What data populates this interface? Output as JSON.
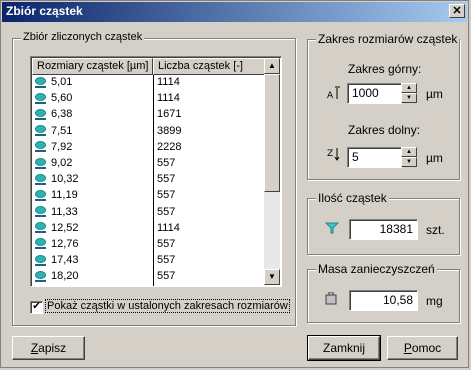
{
  "window": {
    "title": "Zbiór cząstek",
    "close_glyph": "✕"
  },
  "left_group": {
    "label": "Zbiór zliczonych cząstek",
    "columns": [
      "Rozmiary cząstek [µm]",
      "Liczba cząstek [-]"
    ],
    "rows": [
      {
        "size": "5,01",
        "count": "1114"
      },
      {
        "size": "5,60",
        "count": "1114"
      },
      {
        "size": "6,38",
        "count": "1671"
      },
      {
        "size": "7,51",
        "count": "3899"
      },
      {
        "size": "7,92",
        "count": "2228"
      },
      {
        "size": "9,02",
        "count": "557"
      },
      {
        "size": "10,32",
        "count": "557"
      },
      {
        "size": "11,19",
        "count": "557"
      },
      {
        "size": "11,33",
        "count": "557"
      },
      {
        "size": "12,52",
        "count": "1114"
      },
      {
        "size": "12,76",
        "count": "557"
      },
      {
        "size": "17,43",
        "count": "557"
      },
      {
        "size": "18,20",
        "count": "557"
      }
    ],
    "checkbox_checked": true,
    "checkbox_label": "Pokaż cząstki w ustalonych zakresach rozmiarów"
  },
  "range_group": {
    "label": "Zakres rozmiarów cząstek",
    "upper_label": "Zakres górny:",
    "upper_value": "1000",
    "lower_label": "Zakres dolny:",
    "lower_value": "5",
    "unit": "µm"
  },
  "count_group": {
    "label": "Ilość cząstek",
    "value": "18381",
    "unit": "szt."
  },
  "mass_group": {
    "label": "Masa zanieczyszczeń",
    "value": "10,58",
    "unit": "mg"
  },
  "buttons": {
    "save": "Zapisz",
    "close": "Zamknij",
    "help": "Pomoc"
  },
  "colors": {
    "title_start": "#0a246a",
    "title_end": "#a6caf0",
    "icon": "#1e8c8c"
  }
}
